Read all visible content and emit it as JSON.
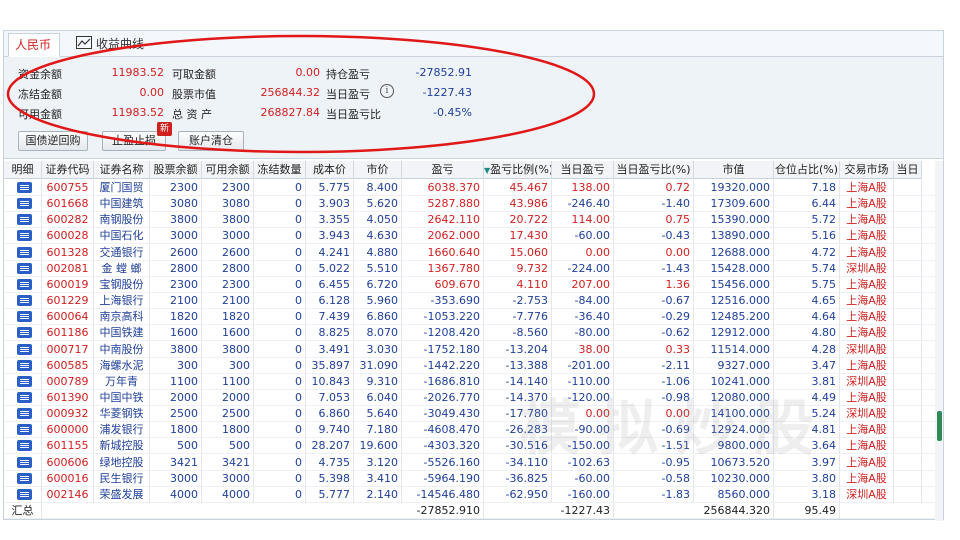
{
  "tabs": [
    {
      "label": "人民币"
    },
    {
      "label": "收益曲线"
    }
  ],
  "summary": {
    "fund_balance_label": "资金余额",
    "fund_balance": "11983.52",
    "withdrawable_label": "可取金额",
    "withdrawable": "0.00",
    "position_pnl_label": "持仓盈亏",
    "position_pnl": "-27852.91",
    "frozen_label": "冻结金额",
    "frozen": "0.00",
    "stock_value_label": "股票市值",
    "stock_value": "256844.32",
    "today_pnl_label": "当日盈亏",
    "today_pnl": "-1227.43",
    "available_label": "可用金额",
    "available": "11983.52",
    "total_assets_label": "总 资 产",
    "total_assets": "268827.84",
    "today_pnl_ratio_label": "当日盈亏比",
    "today_pnl_ratio": "-0.45%",
    "info_icon_glyph": "i"
  },
  "buttons": {
    "repo": "国债逆回购",
    "stop": "止盈止损",
    "new_badge": "新",
    "clear": "账户清仓"
  },
  "columns": [
    "明细",
    "证券代码",
    "证券名称",
    "股票余额",
    "可用余额",
    "冻结数量",
    "成本价",
    "市价",
    "盈亏",
    "盈亏比例(%)",
    "当日盈亏",
    "当日盈亏比(%)",
    "市值",
    "仓位占比(%)",
    "交易市场",
    "当日"
  ],
  "sort_indicator": "▼",
  "rows": [
    [
      "600755",
      "厦门国贸",
      "2300",
      "2300",
      "0",
      "5.775",
      "8.400",
      "6038.370",
      "45.467",
      "138.00",
      "0.72",
      "19320.000",
      "7.18",
      "上海A股"
    ],
    [
      "601668",
      "中国建筑",
      "3080",
      "3080",
      "0",
      "3.903",
      "5.620",
      "5287.880",
      "43.986",
      "-246.40",
      "-1.40",
      "17309.600",
      "6.44",
      "上海A股"
    ],
    [
      "600282",
      "南钢股份",
      "3800",
      "3800",
      "0",
      "3.355",
      "4.050",
      "2642.110",
      "20.722",
      "114.00",
      "0.75",
      "15390.000",
      "5.72",
      "上海A股"
    ],
    [
      "600028",
      "中国石化",
      "3000",
      "3000",
      "0",
      "3.943",
      "4.630",
      "2062.000",
      "17.430",
      "-60.00",
      "-0.43",
      "13890.000",
      "5.16",
      "上海A股"
    ],
    [
      "601328",
      "交通银行",
      "2600",
      "2600",
      "0",
      "4.241",
      "4.880",
      "1660.640",
      "15.060",
      "0.00",
      "0.00",
      "12688.000",
      "4.72",
      "上海A股"
    ],
    [
      "002081",
      "金 螳 螂",
      "2800",
      "2800",
      "0",
      "5.022",
      "5.510",
      "1367.780",
      "9.732",
      "-224.00",
      "-1.43",
      "15428.000",
      "5.74",
      "深圳A股"
    ],
    [
      "600019",
      "宝钢股份",
      "2300",
      "2300",
      "0",
      "6.455",
      "6.720",
      "609.670",
      "4.110",
      "207.00",
      "1.36",
      "15456.000",
      "5.75",
      "上海A股"
    ],
    [
      "601229",
      "上海银行",
      "2100",
      "2100",
      "0",
      "6.128",
      "5.960",
      "-353.690",
      "-2.753",
      "-84.00",
      "-0.67",
      "12516.000",
      "4.65",
      "上海A股"
    ],
    [
      "600064",
      "南京高科",
      "1820",
      "1820",
      "0",
      "7.439",
      "6.860",
      "-1053.220",
      "-7.776",
      "-36.40",
      "-0.29",
      "12485.200",
      "4.64",
      "上海A股"
    ],
    [
      "601186",
      "中国铁建",
      "1600",
      "1600",
      "0",
      "8.825",
      "8.070",
      "-1208.420",
      "-8.560",
      "-80.00",
      "-0.62",
      "12912.000",
      "4.80",
      "上海A股"
    ],
    [
      "000717",
      "中南股份",
      "3800",
      "3800",
      "0",
      "3.491",
      "3.030",
      "-1752.180",
      "-13.204",
      "38.00",
      "0.33",
      "11514.000",
      "4.28",
      "深圳A股"
    ],
    [
      "600585",
      "海螺水泥",
      "300",
      "300",
      "0",
      "35.897",
      "31.090",
      "-1442.220",
      "-13.388",
      "-201.00",
      "-2.11",
      "9327.000",
      "3.47",
      "上海A股"
    ],
    [
      "000789",
      "万年青",
      "1100",
      "1100",
      "0",
      "10.843",
      "9.310",
      "-1686.810",
      "-14.140",
      "-110.00",
      "-1.06",
      "10241.000",
      "3.81",
      "深圳A股"
    ],
    [
      "601390",
      "中国中铁",
      "2000",
      "2000",
      "0",
      "7.053",
      "6.040",
      "-2026.770",
      "-14.370",
      "-120.00",
      "-0.98",
      "12080.000",
      "4.49",
      "上海A股"
    ],
    [
      "000932",
      "华菱钢铁",
      "2500",
      "2500",
      "0",
      "6.860",
      "5.640",
      "-3049.430",
      "-17.780",
      "0.00",
      "0.00",
      "14100.000",
      "5.24",
      "深圳A股"
    ],
    [
      "600000",
      "浦发银行",
      "1800",
      "1800",
      "0",
      "9.740",
      "7.180",
      "-4608.470",
      "-26.283",
      "-90.00",
      "-0.69",
      "12924.000",
      "4.81",
      "上海A股"
    ],
    [
      "601155",
      "新城控股",
      "500",
      "500",
      "0",
      "28.207",
      "19.600",
      "-4303.320",
      "-30.516",
      "-150.00",
      "-1.51",
      "9800.000",
      "3.64",
      "上海A股"
    ],
    [
      "600606",
      "绿地控股",
      "3421",
      "3421",
      "0",
      "4.735",
      "3.120",
      "-5526.160",
      "-34.110",
      "-102.63",
      "-0.95",
      "10673.520",
      "3.97",
      "上海A股"
    ],
    [
      "600016",
      "民生银行",
      "3000",
      "3000",
      "0",
      "5.398",
      "3.410",
      "-5964.190",
      "-36.825",
      "-60.00",
      "-0.58",
      "10230.000",
      "3.80",
      "上海A股"
    ],
    [
      "002146",
      "荣盛发展",
      "4000",
      "4000",
      "0",
      "5.777",
      "2.140",
      "-14546.480",
      "-62.950",
      "-160.00",
      "-1.83",
      "8560.000",
      "3.18",
      "深圳A股"
    ]
  ],
  "total": {
    "label": "汇总",
    "pnl": "-27852.910",
    "today_pnl": "-1227.43",
    "market_value": "256844.320",
    "position_ratio": "95.49"
  },
  "watermark": "模拟炒股",
  "colors": {
    "red": "#d12020",
    "blue": "#1f3f9a",
    "annotation": "#e01818"
  }
}
